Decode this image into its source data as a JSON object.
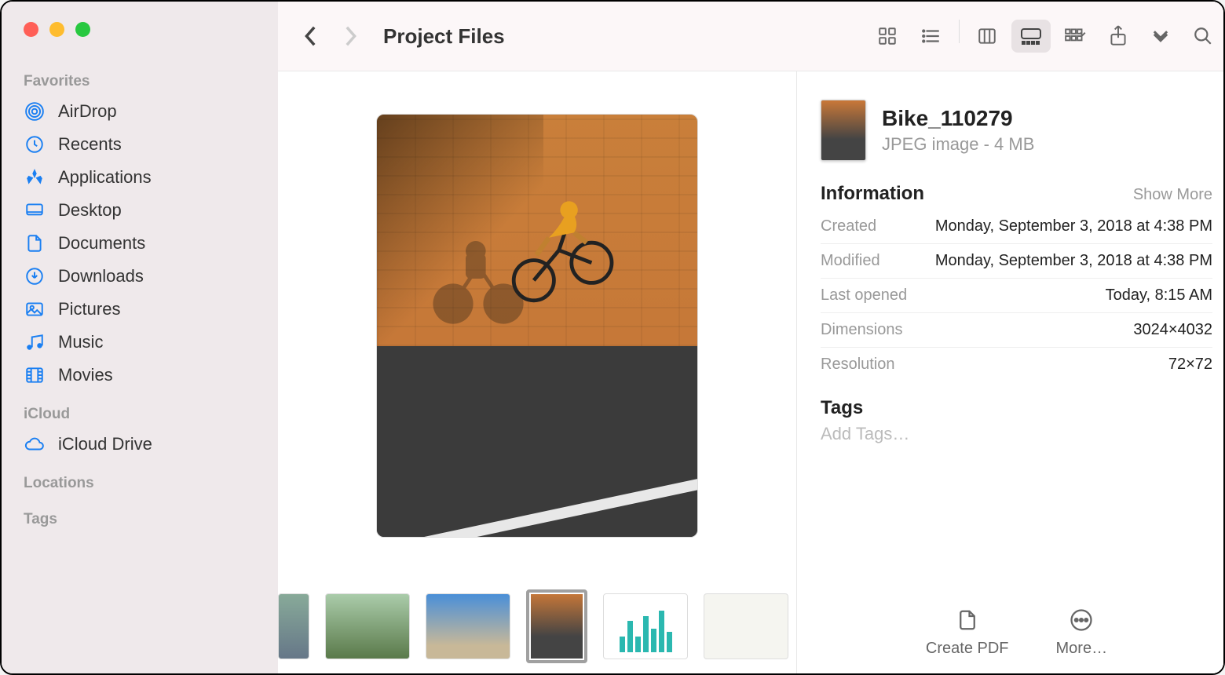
{
  "sidebar": {
    "sections": {
      "favorites": {
        "label": "Favorites"
      },
      "icloud": {
        "label": "iCloud"
      },
      "locations": {
        "label": "Locations"
      },
      "tags": {
        "label": "Tags"
      }
    },
    "favorites": [
      {
        "icon": "airdrop",
        "label": "AirDrop"
      },
      {
        "icon": "recents",
        "label": "Recents"
      },
      {
        "icon": "applications",
        "label": "Applications"
      },
      {
        "icon": "desktop",
        "label": "Desktop"
      },
      {
        "icon": "documents",
        "label": "Documents"
      },
      {
        "icon": "downloads",
        "label": "Downloads"
      },
      {
        "icon": "pictures",
        "label": "Pictures"
      },
      {
        "icon": "music",
        "label": "Music"
      },
      {
        "icon": "movies",
        "label": "Movies"
      }
    ],
    "icloud": [
      {
        "icon": "icloud",
        "label": "iCloud Drive"
      }
    ]
  },
  "toolbar": {
    "title": "Project Files"
  },
  "file": {
    "name": "Bike_110279",
    "kind": "JPEG image - 4 MB"
  },
  "info": {
    "sectionTitle": "Information",
    "showMore": "Show More",
    "rows": [
      {
        "label": "Created",
        "value": "Monday, September 3, 2018 at 4:38 PM"
      },
      {
        "label": "Modified",
        "value": "Monday, September 3, 2018 at 4:38 PM"
      },
      {
        "label": "Last opened",
        "value": "Today, 8:15 AM"
      },
      {
        "label": "Dimensions",
        "value": "3024×4032"
      },
      {
        "label": "Resolution",
        "value": "72×72"
      }
    ]
  },
  "tags": {
    "title": "Tags",
    "placeholder": "Add Tags…"
  },
  "actions": {
    "createPdf": "Create PDF",
    "more": "More…"
  }
}
